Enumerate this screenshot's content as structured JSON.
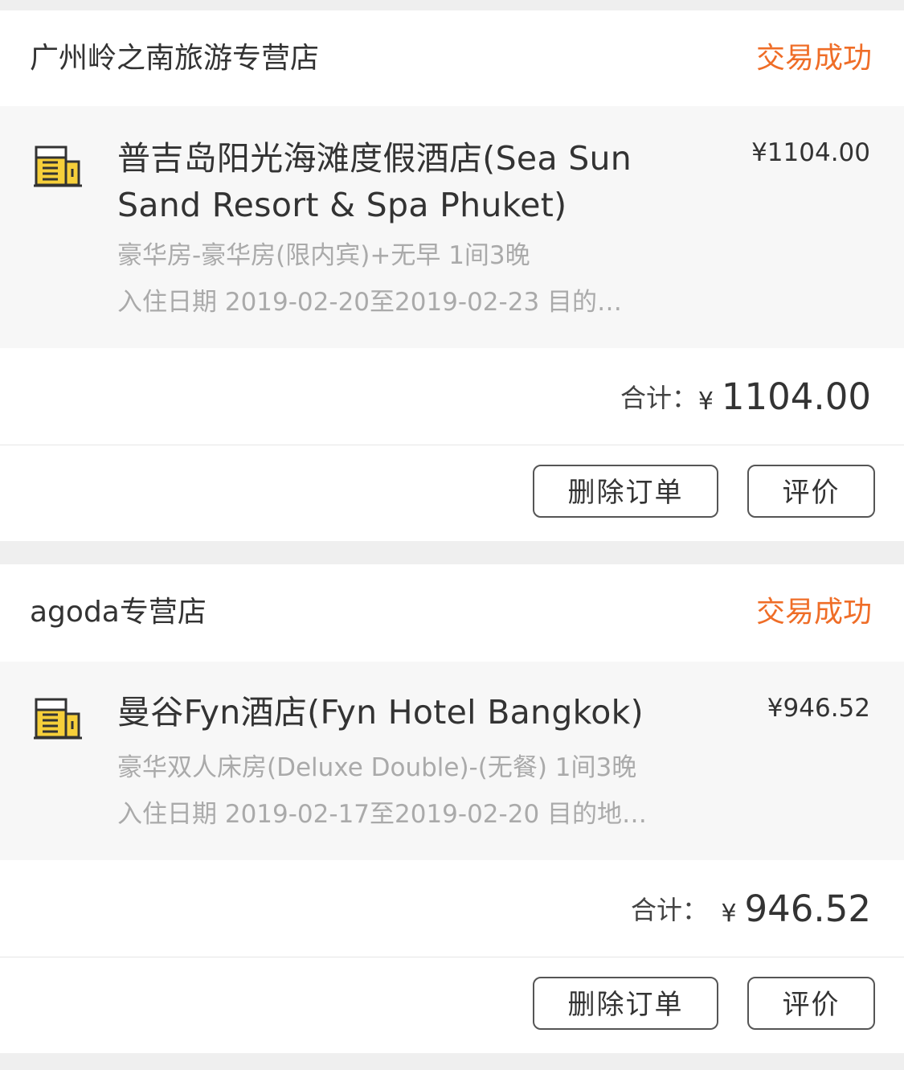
{
  "orders": [
    {
      "shop": "广州岭之南旅游专营店",
      "status": "交易成功",
      "item_icon": "hotel-building-icon",
      "item_title": "普吉岛阳光海滩度假酒店(Sea Sun Sand Resort & Spa Phuket)",
      "item_price": "¥1104.00",
      "room": "豪华房-豪华房(限内宾)+无早 1间3晚",
      "dates": "入住日期 2019-02-20至2019-02-23 目的…",
      "total_label": "合计：",
      "total_currency": "¥",
      "total_amount": "1104.00",
      "delete_label": "删除订单",
      "review_label": "评价"
    },
    {
      "shop": "agoda专营店",
      "status": "交易成功",
      "item_icon": "hotel-building-icon",
      "item_title": "曼谷Fyn酒店(Fyn Hotel Bangkok)",
      "item_price": "¥946.52",
      "room": "豪华双人床房(Deluxe Double)-(无餐) 1间3晚",
      "dates": "入住日期 2019-02-17至2019-02-20 目的地…",
      "total_label": "合计：",
      "total_currency": "¥",
      "total_amount": "946.52",
      "delete_label": "删除订单",
      "review_label": "评价"
    }
  ],
  "colors": {
    "status": "#ef6d27",
    "page_bg": "#efefef",
    "item_bg": "#f7f7f7",
    "icon_yellow": "#f6cf3a"
  }
}
